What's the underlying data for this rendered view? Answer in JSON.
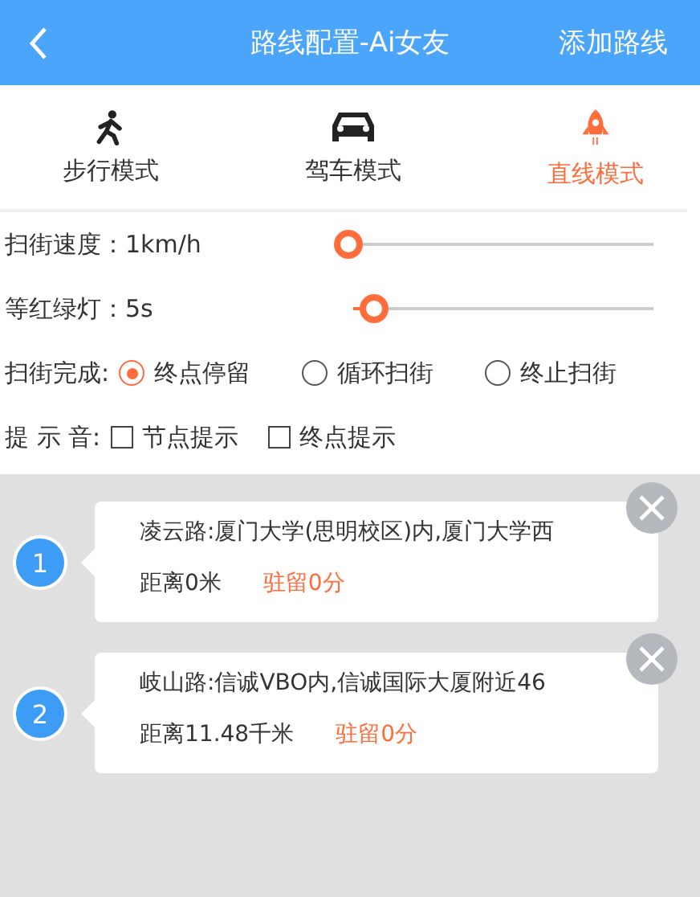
{
  "header": {
    "title": "路线配置-Ai女友",
    "action": "添加路线"
  },
  "modes": [
    {
      "kind": "walk",
      "label": "步行模式",
      "selected": false
    },
    {
      "kind": "car",
      "label": "驾车模式",
      "selected": false
    },
    {
      "kind": "rocket",
      "label": "直线模式",
      "selected": true
    }
  ],
  "sliders": [
    {
      "label": "扫街速度：1km/h",
      "level": 0
    },
    {
      "label": "等红绿灯：5s",
      "level": 0.07
    }
  ],
  "finish": {
    "label": "扫街完成:",
    "options": [
      {
        "label": "终点停留",
        "selected": true
      },
      {
        "label": "循环扫街",
        "selected": false
      },
      {
        "label": "终止扫街",
        "selected": false
      }
    ]
  },
  "sound": {
    "label": "提 示 音:",
    "options": [
      {
        "label": "节点提示",
        "checked": false
      },
      {
        "label": "终点提示",
        "checked": false
      }
    ]
  },
  "points": [
    {
      "number": "1",
      "address": "凌云路:厦门大学(思明校区)内,厦门大学西",
      "distance": "距离0米",
      "stay": "驻留0分"
    },
    {
      "number": "2",
      "address": "岐山路:信诚VBO内,信诚国际大厦附近46",
      "distance": "距离11.48千米",
      "stay": "驻留0分"
    }
  ]
}
